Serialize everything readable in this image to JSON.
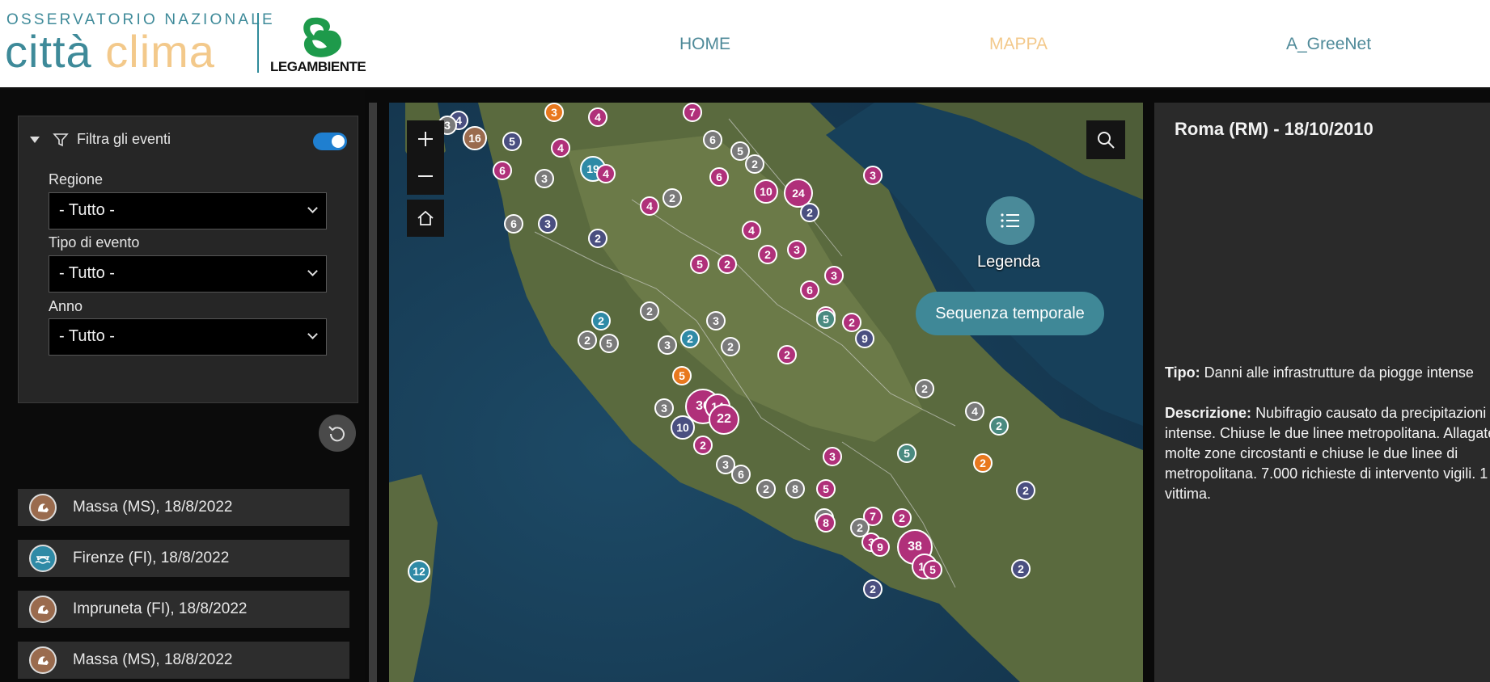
{
  "header": {
    "logo_top": "OSSERVATORIO NAZIONALE",
    "logo_citta": "città",
    "logo_clima": "clima",
    "partner": "LEGAMBIENTE",
    "nav": [
      {
        "label": "HOME",
        "active": false
      },
      {
        "label": "MAPPA",
        "active": true
      },
      {
        "label": "A_GreeNet",
        "active": false
      }
    ],
    "colors": {
      "teal": "#3e8a99",
      "sand": "#f3c98b",
      "green": "#2a9a4a"
    }
  },
  "filters": {
    "title": "Filtra gli eventi",
    "enabled": true,
    "fields": [
      {
        "label": "Regione",
        "value": "- Tutto -"
      },
      {
        "label": "Tipo di evento",
        "value": "- Tutto -"
      },
      {
        "label": "Anno",
        "value": "- Tutto -"
      }
    ],
    "reset_icon": "reset-icon"
  },
  "events": [
    {
      "label": "Massa  (MS), 18/8/2022",
      "icon": "landslide-icon",
      "color": "#9a6b4e"
    },
    {
      "label": "Firenze  (FI), 18/8/2022",
      "icon": "bridge-flood-icon",
      "color": "#2f8aa6"
    },
    {
      "label": "Impruneta  (FI), 18/8/2022",
      "icon": "landslide-icon",
      "color": "#9a6b4e"
    },
    {
      "label": "Massa  (MS), 18/8/2022",
      "icon": "landslide-icon",
      "color": "#9a6b4e"
    }
  ],
  "map": {
    "legend_label": "Legenda",
    "timeline_label": "Sequenza temporale",
    "controls": [
      "zoom-in-icon",
      "zoom-out-icon",
      "home-icon",
      "search-icon"
    ],
    "category_colors": {
      "flood": "#b0307a",
      "landslide": "#9a6b4e",
      "infrastructure": "#2f8aa6",
      "storm": "#4a8a80",
      "drought": "#e8781e",
      "mixed": "#4a4f80",
      "other": "#7a7a7a"
    },
    "clusters": [
      {
        "n": "4",
        "cat": "mixed"
      },
      {
        "n": "3",
        "cat": "other"
      },
      {
        "n": "16",
        "cat": "landslide"
      },
      {
        "n": "5",
        "cat": "mixed"
      },
      {
        "n": "3",
        "cat": "drought"
      },
      {
        "n": "4",
        "cat": "flood"
      },
      {
        "n": "7",
        "cat": "flood"
      },
      {
        "n": "4",
        "cat": "flood"
      },
      {
        "n": "6",
        "cat": "other"
      },
      {
        "n": "19",
        "cat": "infrastructure"
      },
      {
        "n": "4",
        "cat": "flood"
      },
      {
        "n": "6",
        "cat": "flood"
      },
      {
        "n": "3",
        "cat": "other"
      },
      {
        "n": "5",
        "cat": "other"
      },
      {
        "n": "2",
        "cat": "other"
      },
      {
        "n": "6",
        "cat": "flood"
      },
      {
        "n": "4",
        "cat": "flood"
      },
      {
        "n": "3",
        "cat": "flood"
      },
      {
        "n": "10",
        "cat": "flood"
      },
      {
        "n": "24",
        "cat": "flood"
      },
      {
        "n": "2",
        "cat": "mixed"
      },
      {
        "n": "6",
        "cat": "other"
      },
      {
        "n": "3",
        "cat": "mixed"
      },
      {
        "n": "2",
        "cat": "mixed"
      },
      {
        "n": "2",
        "cat": "other"
      },
      {
        "n": "4",
        "cat": "flood"
      },
      {
        "n": "3",
        "cat": "flood"
      },
      {
        "n": "5",
        "cat": "flood"
      },
      {
        "n": "2",
        "cat": "flood"
      },
      {
        "n": "2",
        "cat": "flood"
      },
      {
        "n": "6",
        "cat": "flood"
      },
      {
        "n": "3",
        "cat": "flood"
      },
      {
        "n": "5",
        "cat": "flood"
      },
      {
        "n": "2",
        "cat": "other"
      },
      {
        "n": "3",
        "cat": "other"
      },
      {
        "n": "5",
        "cat": "storm"
      },
      {
        "n": "2",
        "cat": "flood"
      },
      {
        "n": "2",
        "cat": "infrastructure"
      },
      {
        "n": "2",
        "cat": "other"
      },
      {
        "n": "5",
        "cat": "other"
      },
      {
        "n": "3",
        "cat": "other"
      },
      {
        "n": "2",
        "cat": "infrastructure"
      },
      {
        "n": "2",
        "cat": "other"
      },
      {
        "n": "9",
        "cat": "mixed"
      },
      {
        "n": "2",
        "cat": "flood"
      },
      {
        "n": "5",
        "cat": "drought"
      },
      {
        "n": "36",
        "cat": "flood"
      },
      {
        "n": "14",
        "cat": "flood"
      },
      {
        "n": "22",
        "cat": "flood"
      },
      {
        "n": "3",
        "cat": "other"
      },
      {
        "n": "10",
        "cat": "mixed"
      },
      {
        "n": "2",
        "cat": "flood"
      },
      {
        "n": "3",
        "cat": "other"
      },
      {
        "n": "6",
        "cat": "other"
      },
      {
        "n": "2",
        "cat": "other"
      },
      {
        "n": "8",
        "cat": "other"
      },
      {
        "n": "5",
        "cat": "flood"
      },
      {
        "n": "3",
        "cat": "other"
      },
      {
        "n": "3",
        "cat": "flood"
      },
      {
        "n": "2",
        "cat": "other"
      },
      {
        "n": "4",
        "cat": "other"
      },
      {
        "n": "2",
        "cat": "storm"
      },
      {
        "n": "2",
        "cat": "drought"
      },
      {
        "n": "5",
        "cat": "storm"
      },
      {
        "n": "7",
        "cat": "flood"
      },
      {
        "n": "2",
        "cat": "flood"
      },
      {
        "n": "3",
        "cat": "flood"
      },
      {
        "n": "2",
        "cat": "other"
      },
      {
        "n": "9",
        "cat": "flood"
      },
      {
        "n": "38",
        "cat": "flood"
      },
      {
        "n": "14",
        "cat": "flood"
      },
      {
        "n": "5",
        "cat": "flood"
      },
      {
        "n": "8",
        "cat": "flood"
      },
      {
        "n": "2",
        "cat": "mixed"
      },
      {
        "n": "2",
        "cat": "mixed"
      },
      {
        "n": "12",
        "cat": "infrastructure"
      },
      {
        "n": "2",
        "cat": "mixed"
      }
    ]
  },
  "details": {
    "title": "Roma (RM) - 18/10/2010",
    "tipo_label": "Tipo:",
    "tipo_value": "Danni alle infrastrutture da piogge intense",
    "desc_label": "Descrizione:",
    "desc_value": "Nubifragio causato da precipitazioni intense. Chiuse le due linee metropolitana. Allagate molte zone circostanti e chiuse le due linee di metropolitana. 7.000 richieste di intervento vigili. 1 vittima."
  }
}
